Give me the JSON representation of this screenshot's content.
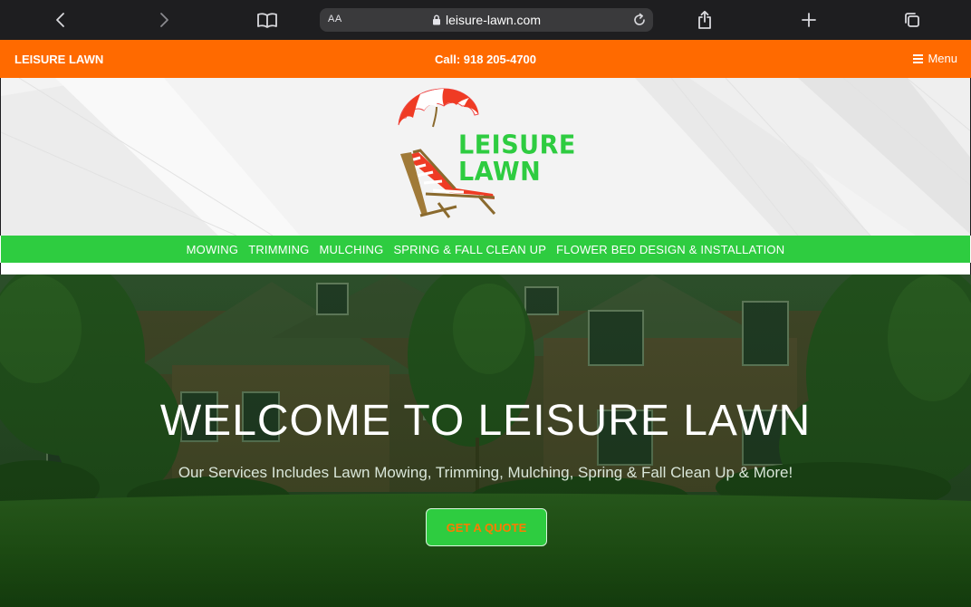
{
  "browser": {
    "text_size_label": "AA",
    "url": "leisure-lawn.com"
  },
  "topbar": {
    "brand": "LEISURE LAWN",
    "phone": "Call: 918 205-4700",
    "menu_label": "Menu"
  },
  "logo": {
    "line1": "LEISURE",
    "line2": "LAWN"
  },
  "nav": {
    "items": [
      "MOWING",
      "TRIMMING",
      "MULCHING",
      "SPRING & FALL CLEAN UP",
      "FLOWER BED DESIGN & INSTALLATION"
    ]
  },
  "hero": {
    "title": "WELCOME TO LEISURE LAWN",
    "subtitle": "Our Services Includes Lawn Mowing, Trimming, Mulching, Spring & Fall Clean Up & More!",
    "cta_label": "GET A QUOTE"
  },
  "icons": {
    "toolbar": [
      "chevron-left-icon",
      "chevron-right-icon",
      "book-icon",
      "lock-icon",
      "reload-icon",
      "share-icon",
      "plus-icon",
      "tabs-icon"
    ],
    "menu": "hamburger-icon"
  },
  "colors": {
    "topbar": "#ff6a00",
    "nav_green": "#2ecc40",
    "cta_text": "#ff7a00",
    "browser_chrome": "#1e1e20"
  }
}
